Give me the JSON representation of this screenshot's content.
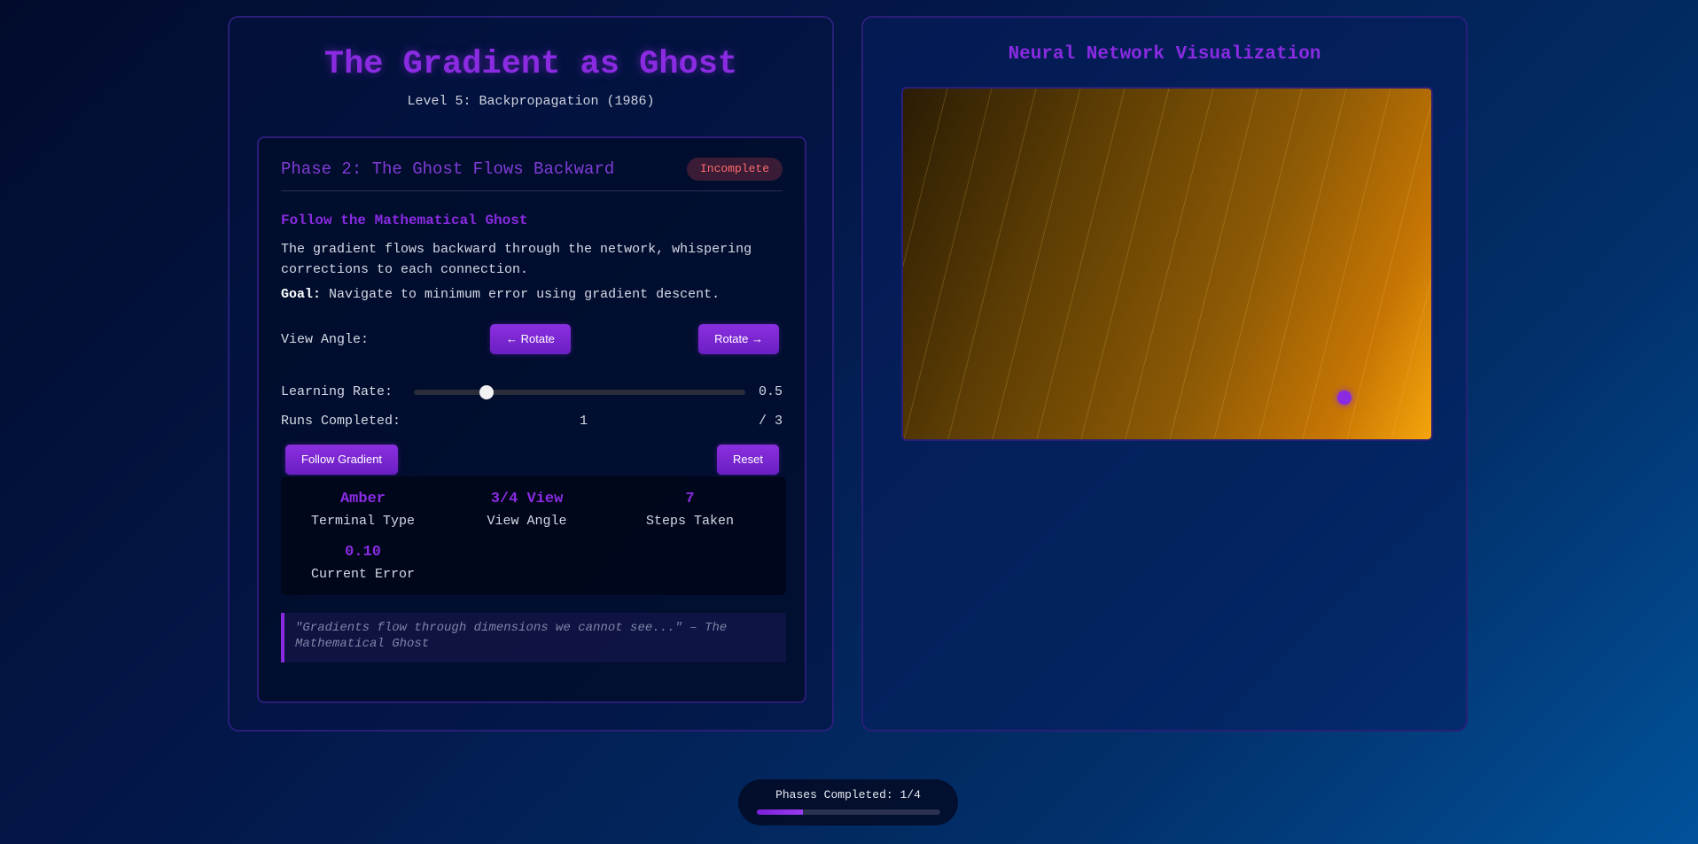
{
  "header": {
    "title": "The Gradient as Ghost",
    "subtitle": "Level 5: Backpropagation (1986)"
  },
  "phase": {
    "title": "Phase 2: The Ghost Flows Backward",
    "status": "Incomplete",
    "heading": "Follow the Mathematical Ghost",
    "description": "The gradient flows backward through the network, whispering corrections to each connection.",
    "goal_label": "Goal:",
    "goal_text": "Navigate to minimum error using gradient descent."
  },
  "controls": {
    "view_angle_label": "View Angle:",
    "rotate_left_label": "← Rotate",
    "rotate_right_label": "Rotate →",
    "learning_rate_label": "Learning Rate:",
    "learning_rate_value": "0.5",
    "learning_rate_fraction": 0.22,
    "runs_label": "Runs Completed:",
    "runs_value": "1",
    "runs_total": "/ 3",
    "follow_button": "Follow Gradient",
    "reset_button": "Reset"
  },
  "stats": [
    {
      "value": "Amber",
      "label": "Terminal Type"
    },
    {
      "value": "3/4 View",
      "label": "View Angle"
    },
    {
      "value": "7",
      "label": "Steps Taken"
    },
    {
      "value": "0.10",
      "label": "Current Error"
    }
  ],
  "quote": "\"Gradients flow through dimensions we cannot see...\" – The Mathematical Ghost",
  "visualization": {
    "title": "Neural Network Visualization",
    "colors": {
      "dark": "#2a1c04",
      "mid": "#8d5a05",
      "bright": "#f5a50b",
      "ball": "#8a2be2"
    }
  },
  "progress": {
    "label": "Phases Completed: 1/4",
    "fraction": 0.25
  }
}
